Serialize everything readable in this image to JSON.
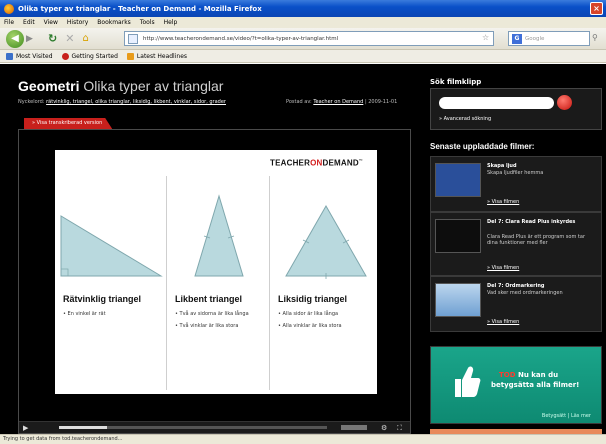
{
  "window": {
    "title": "Olika typer av trianglar - Teacher on Demand - Mozilla Firefox"
  },
  "menu": [
    "File",
    "Edit",
    "View",
    "History",
    "Bookmarks",
    "Tools",
    "Help"
  ],
  "toolbar": {
    "url": "http://www.teacherondemand.se/video/?t=olika-typer-av-trianglar.html",
    "search_placeholder": "Google"
  },
  "bookmarks": [
    {
      "label": "Most Visited",
      "color": "#3b70c9"
    },
    {
      "label": "Getting Started",
      "color": "#c8201c"
    },
    {
      "label": "Latest Headlines",
      "color": "#e89b1a"
    }
  ],
  "page": {
    "title_bold": "Geometri",
    "title_rest": "Olika typer av trianglar",
    "crumbs_prefix": "Nyckelord:",
    "crumbs_links": "rätvinklig, triangel, olika trianglar, liksidig, likbent, vinklar, sidor, grader",
    "posted_prefix": "Postad av:",
    "posted_link": "Teacher on Demand",
    "posted_date": "| 2009-11-01",
    "tab_label": "» Visa transkriberad version",
    "logo_prefix": "TEACHER",
    "logo_on": "ON",
    "logo_suffix": "DEMAND"
  },
  "slide": {
    "columns": [
      {
        "title": "Rätvinklig triangel",
        "bullets": [
          "• En vinkel är rät"
        ]
      },
      {
        "title": "Likbent triangel",
        "bullets": [
          "• Två av sidorna är lika långa",
          "• Två vinklar är lika stora"
        ]
      },
      {
        "title": "Liksidig triangel",
        "bullets": [
          "• Alla sidor är lika långa",
          "• Alla vinklar är lika stora"
        ]
      }
    ]
  },
  "player": {
    "progress": 0.18
  },
  "sidebar": {
    "search_heading": "Sök filmklipp",
    "advanced_link": "» Avancerad sökning",
    "recent_heading": "Senaste uppladdade filmer:",
    "recent": [
      {
        "title": "Skapa ljud",
        "desc": "Skapa ljudfiler hemma",
        "link": "» Visa filmen"
      },
      {
        "title": "Del 7: Clara Read Plus inkyrdes",
        "desc": "Clara Read Plus är ett program som tar dina funktioner med fler",
        "link": "» Visa filmen"
      },
      {
        "title": "Del 7: Ordmarkering",
        "desc": "Vad sker med ordmarkeringen",
        "link": "» Visa filmen"
      }
    ],
    "ad_brand": "TOD",
    "ad_line1": "Nu kan du",
    "ad_line2": "betygsätta alla filmer!",
    "ad_foot": "Betygsätt | Läs mer"
  },
  "status": {
    "text": "Trying to get data from tod.teacherondemand..."
  }
}
